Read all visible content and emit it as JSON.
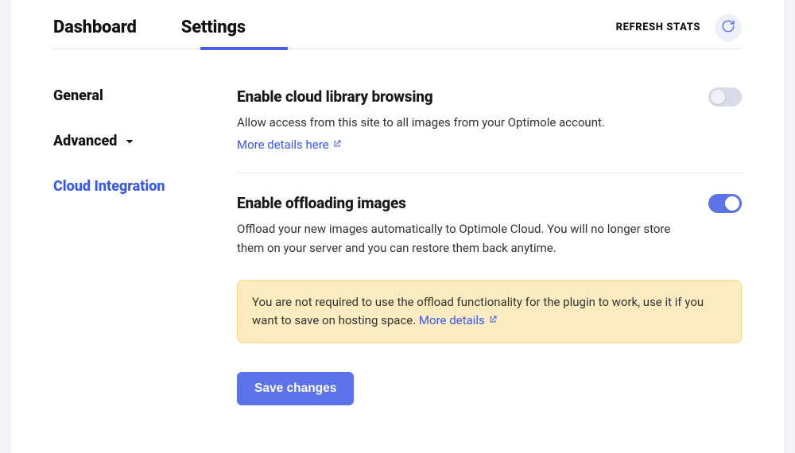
{
  "tabs": {
    "dashboard": "Dashboard",
    "settings": "Settings"
  },
  "topbar": {
    "refresh_stats": "REFRESH STATS"
  },
  "sidebar": {
    "general": "General",
    "advanced": "Advanced",
    "cloud_integration": "Cloud Integration"
  },
  "sections": {
    "cloud_library": {
      "title": "Enable cloud library browsing",
      "desc": "Allow access from this site to all images from your Optimole account.",
      "link": "More details here"
    },
    "offloading": {
      "title": "Enable offloading images",
      "desc": "Offload your new images automatically to Optimole Cloud. You will no longer store them on your server and you can restore them back anytime.",
      "notice": "You are not required to use the offload functionality for the plugin to work, use it if you want to save on hosting space. ",
      "notice_link": "More details"
    }
  },
  "buttons": {
    "save": "Save changes"
  }
}
